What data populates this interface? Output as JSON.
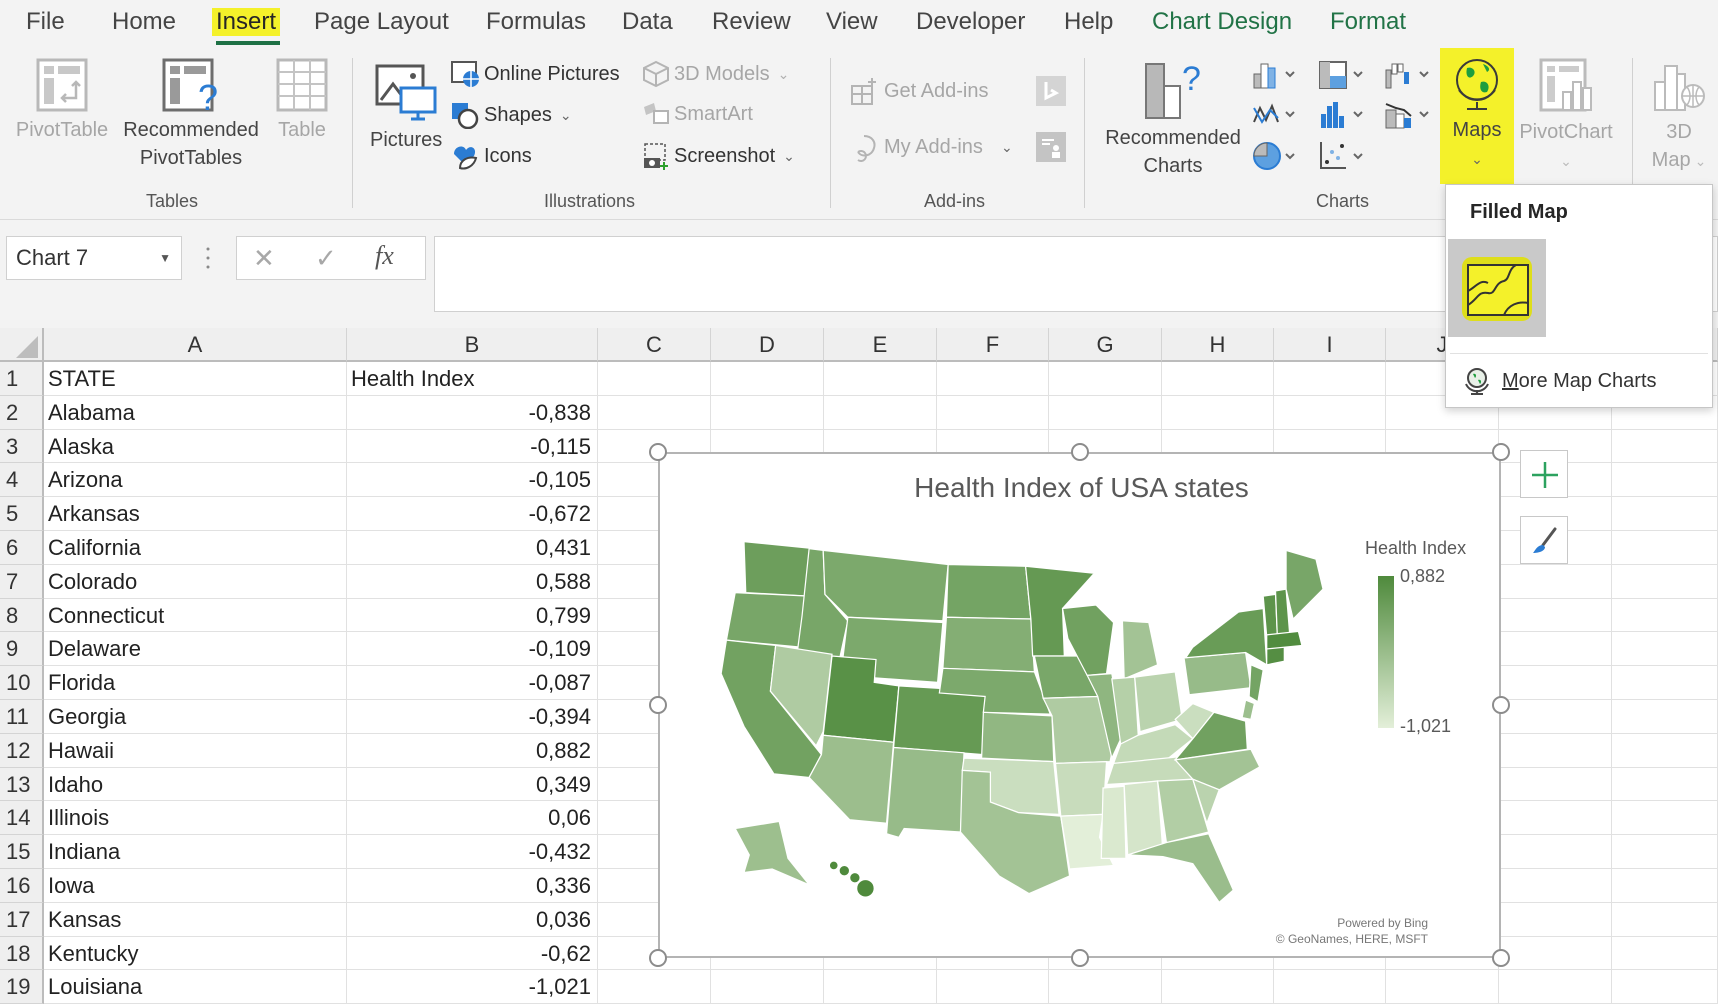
{
  "tabs": [
    {
      "label": "File",
      "state": "normal"
    },
    {
      "label": "Home",
      "state": "normal"
    },
    {
      "label": "Insert",
      "state": "active"
    },
    {
      "label": "Page Layout",
      "state": "normal"
    },
    {
      "label": "Formulas",
      "state": "normal"
    },
    {
      "label": "Data",
      "state": "normal"
    },
    {
      "label": "Review",
      "state": "normal"
    },
    {
      "label": "View",
      "state": "normal"
    },
    {
      "label": "Developer",
      "state": "normal"
    },
    {
      "label": "Help",
      "state": "normal"
    },
    {
      "label": "Chart Design",
      "state": "contextual"
    },
    {
      "label": "Format",
      "state": "contextual"
    }
  ],
  "ribbon": {
    "tables": {
      "label": "Tables",
      "pivottable": "PivotTable",
      "recommended_pivottables_1": "Recommended",
      "recommended_pivottables_2": "PivotTables",
      "table": "Table"
    },
    "illustrations": {
      "label": "Illustrations",
      "pictures": "Pictures",
      "online_pictures": "Online Pictures",
      "shapes": "Shapes",
      "icons": "Icons",
      "models_3d": "3D Models",
      "smartart": "SmartArt",
      "screenshot": "Screenshot"
    },
    "addins": {
      "label": "Add-ins",
      "get_addins": "Get Add-ins",
      "my_addins": "My Add-ins"
    },
    "charts": {
      "label": "Charts",
      "recommended_charts_1": "Recommended",
      "recommended_charts_2": "Charts",
      "maps": "Maps",
      "pivotchart": "PivotChart"
    },
    "tours": {
      "map3d_1": "3D",
      "map3d_2": "Map"
    }
  },
  "maps_menu": {
    "section_title": "Filled Map",
    "more_label": "More Map Charts",
    "more_accel": "M"
  },
  "formula_bar": {
    "name_box": "Chart 7",
    "formula": ""
  },
  "colors": {
    "accent_green": "#217346",
    "highlight": "#f4f12a",
    "map_low": "#e3efd9",
    "map_high": "#4f8a3c"
  },
  "columns": [
    "A",
    "B",
    "C",
    "D",
    "E",
    "F",
    "G",
    "H",
    "I",
    "J"
  ],
  "header_row": {
    "row": "1",
    "a": "STATE",
    "b": "Health Index"
  },
  "rows": [
    {
      "row": "2",
      "state": "Alabama",
      "value": "-0,838"
    },
    {
      "row": "3",
      "state": "Alaska",
      "value": "-0,115"
    },
    {
      "row": "4",
      "state": "Arizona",
      "value": "-0,105"
    },
    {
      "row": "5",
      "state": "Arkansas",
      "value": "-0,672"
    },
    {
      "row": "6",
      "state": "California",
      "value": "0,431"
    },
    {
      "row": "7",
      "state": "Colorado",
      "value": "0,588"
    },
    {
      "row": "8",
      "state": "Connecticut",
      "value": "0,799"
    },
    {
      "row": "9",
      "state": "Delaware",
      "value": "-0,109"
    },
    {
      "row": "10",
      "state": "Florida",
      "value": "-0,087"
    },
    {
      "row": "11",
      "state": "Georgia",
      "value": "-0,394"
    },
    {
      "row": "12",
      "state": "Hawaii",
      "value": "0,882"
    },
    {
      "row": "13",
      "state": "Idaho",
      "value": "0,349"
    },
    {
      "row": "14",
      "state": "Illinois",
      "value": "0,06"
    },
    {
      "row": "15",
      "state": "Indiana",
      "value": "-0,432"
    },
    {
      "row": "16",
      "state": "Iowa",
      "value": "0,336"
    },
    {
      "row": "17",
      "state": "Kansas",
      "value": "0,036"
    },
    {
      "row": "18",
      "state": "Kentucky",
      "value": "-0,62"
    },
    {
      "row": "19",
      "state": "Louisiana",
      "value": "-1,021"
    }
  ],
  "chart": {
    "title": "Health Index of USA states",
    "legend_title": "Health Index",
    "legend_max": "0,882",
    "legend_min": "-1,021",
    "attribution_1": "Powered by Bing",
    "attribution_2": "© GeoNames, HERE, MSFT"
  },
  "chart_data": {
    "type": "heatmap",
    "subtype": "filled-map",
    "title": "Health Index of USA states",
    "legend": {
      "title": "Health Index",
      "min": -1.021,
      "max": 0.882,
      "placement": "right"
    },
    "categories": [
      "Alabama",
      "Alaska",
      "Arizona",
      "Arkansas",
      "California",
      "Colorado",
      "Connecticut",
      "Delaware",
      "Florida",
      "Georgia",
      "Hawaii",
      "Idaho",
      "Illinois",
      "Indiana",
      "Iowa",
      "Kansas",
      "Kentucky",
      "Louisiana"
    ],
    "values": [
      -0.838,
      -0.115,
      -0.105,
      -0.672,
      0.431,
      0.588,
      0.799,
      -0.109,
      -0.087,
      -0.394,
      0.882,
      0.349,
      0.06,
      -0.432,
      0.336,
      0.036,
      -0.62,
      -1.021
    ]
  }
}
